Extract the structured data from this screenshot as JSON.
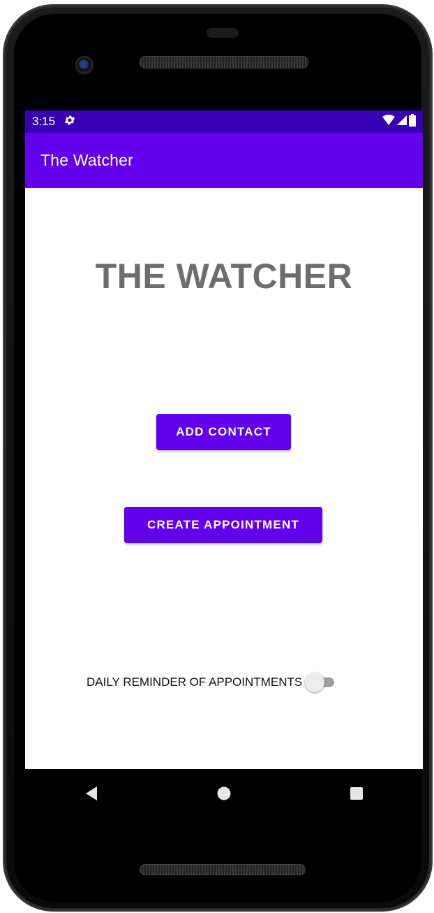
{
  "status_bar": {
    "time": "3:15",
    "icons": [
      "settings-gear-icon",
      "wifi-icon",
      "cell-signal-icon",
      "battery-icon"
    ]
  },
  "app_bar": {
    "title": "The Watcher"
  },
  "main": {
    "heading": "THE WATCHER",
    "add_contact_label": "ADD CONTACT",
    "create_appointment_label": "CREATE APPOINTMENT",
    "reminder_label": "DAILY REMINDER OF APPOINTMENTS",
    "reminder_enabled": false
  },
  "nav_bar": {
    "icons": [
      "back-icon",
      "home-icon",
      "recents-icon"
    ]
  },
  "colors": {
    "status_bar": "#3700b3",
    "app_bar": "#6200ee",
    "button": "#6200ee",
    "heading": "#6d6d6d"
  }
}
